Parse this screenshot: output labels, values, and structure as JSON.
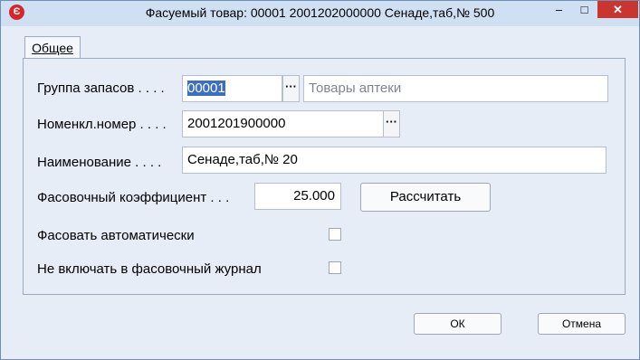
{
  "window": {
    "title": "Фасуемый товар: 00001 2001202000000 Сенаде,таб,№ 500",
    "app_icon": "app-logo-icon",
    "minimize_glyph": "‒",
    "maximize_glyph": "□",
    "close_glyph": "✕"
  },
  "tabs": [
    {
      "label": "Общее"
    }
  ],
  "form": {
    "stock_group": {
      "label": "Группа запасов . . . .",
      "value": "00001",
      "picker": "···",
      "name_placeholder": "Товары аптеки"
    },
    "nomenclature": {
      "label": "Номенкл.номер . . . .",
      "value": "2001201900000",
      "picker": "···"
    },
    "name": {
      "label": "Наименование . . . .",
      "value": "Сенаде,таб,№ 20"
    },
    "packing_coef": {
      "label": "Фасовочный коэффициент . . .",
      "value": "25.000",
      "calc_button": "Рассчитать"
    },
    "auto_pack": {
      "label": "Фасовать автоматически",
      "checked": false
    },
    "exclude_journal": {
      "label": "Не включать в фасовочный журнал",
      "checked": false
    }
  },
  "footer": {
    "ok_label": "ОК",
    "cancel_label": "Отмена"
  },
  "colors": {
    "window_bg": "#e6edf7",
    "titlebar_bg": "#cfe0f3",
    "close_bg": "#c9352f",
    "selection": "#3c6fc0",
    "app_icon_red": "#d6262b"
  }
}
